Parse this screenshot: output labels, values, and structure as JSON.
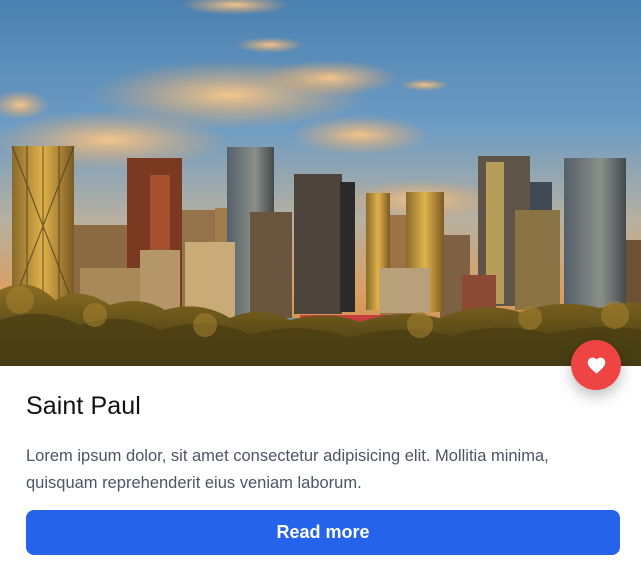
{
  "card": {
    "title": "Saint Paul",
    "description": "Lorem ipsum dolor, sit amet consectetur adipisicing elit. Mollitia minima, quisquam reprehenderit eius veniam laborum.",
    "button_label": "Read more",
    "image_alt": "city-skyline-photo",
    "favorite_icon": "heart-icon"
  },
  "colors": {
    "accent": "#2563eb",
    "favorite": "#ef4444",
    "title": "#111111",
    "body_text": "#4b5563"
  }
}
